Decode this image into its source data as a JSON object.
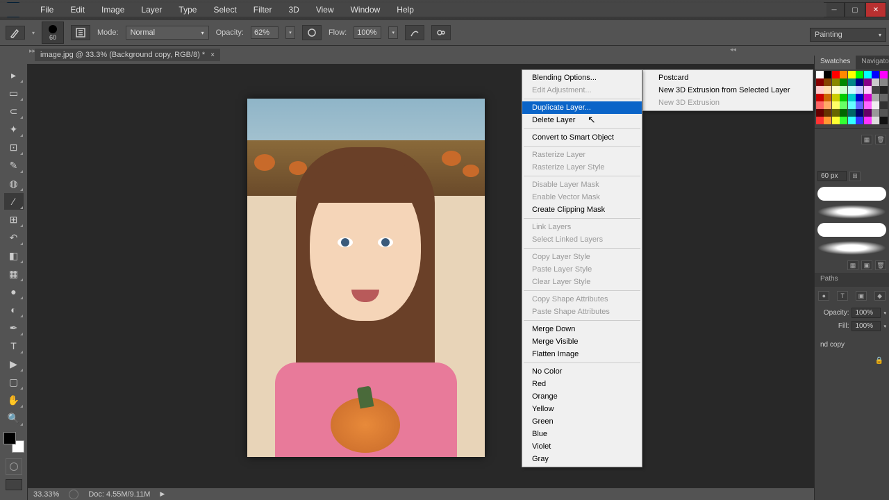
{
  "window": {
    "title": "Ps"
  },
  "menubar": [
    "File",
    "Edit",
    "Image",
    "Layer",
    "Type",
    "Select",
    "Filter",
    "3D",
    "View",
    "Window",
    "Help"
  ],
  "options": {
    "brush_size": "60",
    "mode_label": "Mode:",
    "mode_value": "Normal",
    "opacity_label": "Opacity:",
    "opacity_value": "62%",
    "flow_label": "Flow:",
    "flow_value": "100%",
    "workspace": "Painting"
  },
  "document": {
    "tab_label": "image.jpg @ 33.3% (Background copy, RGB/8) *"
  },
  "statusbar": {
    "zoom": "33.33%",
    "doc_info": "Doc: 4.55M/9.11M"
  },
  "context_menu": {
    "groups": [
      [
        {
          "label": "Blending Options...",
          "enabled": true
        },
        {
          "label": "Edit Adjustment...",
          "enabled": false
        }
      ],
      [
        {
          "label": "Duplicate Layer...",
          "enabled": true,
          "highlight": true
        },
        {
          "label": "Delete Layer",
          "enabled": true
        }
      ],
      [
        {
          "label": "Convert to Smart Object",
          "enabled": true
        }
      ],
      [
        {
          "label": "Rasterize Layer",
          "enabled": false
        },
        {
          "label": "Rasterize Layer Style",
          "enabled": false
        }
      ],
      [
        {
          "label": "Disable Layer Mask",
          "enabled": false
        },
        {
          "label": "Enable Vector Mask",
          "enabled": false
        },
        {
          "label": "Create Clipping Mask",
          "enabled": true
        }
      ],
      [
        {
          "label": "Link Layers",
          "enabled": false
        },
        {
          "label": "Select Linked Layers",
          "enabled": false
        }
      ],
      [
        {
          "label": "Copy Layer Style",
          "enabled": false
        },
        {
          "label": "Paste Layer Style",
          "enabled": false
        },
        {
          "label": "Clear Layer Style",
          "enabled": false
        }
      ],
      [
        {
          "label": "Copy Shape Attributes",
          "enabled": false
        },
        {
          "label": "Paste Shape Attributes",
          "enabled": false
        }
      ],
      [
        {
          "label": "Merge Down",
          "enabled": true
        },
        {
          "label": "Merge Visible",
          "enabled": true
        },
        {
          "label": "Flatten Image",
          "enabled": true
        }
      ],
      [
        {
          "label": "No Color",
          "enabled": true
        },
        {
          "label": "Red",
          "enabled": true
        },
        {
          "label": "Orange",
          "enabled": true
        },
        {
          "label": "Yellow",
          "enabled": true
        },
        {
          "label": "Green",
          "enabled": true
        },
        {
          "label": "Blue",
          "enabled": true
        },
        {
          "label": "Violet",
          "enabled": true
        },
        {
          "label": "Gray",
          "enabled": true
        }
      ]
    ]
  },
  "submenu": [
    {
      "label": "Postcard",
      "enabled": true
    },
    {
      "label": "New 3D Extrusion from Selected Layer",
      "enabled": true
    },
    {
      "label": "New 3D Extrusion",
      "enabled": false
    }
  ],
  "panels": {
    "swatches_tab": "Swatches",
    "navigator_tab": "Navigator",
    "paths_tab": "Paths",
    "brush_size": "60 px",
    "opacity_label": "Opacity:",
    "opacity_value": "100%",
    "fill_label": "Fill:",
    "fill_value": "100%",
    "layer_name": "nd copy"
  },
  "swatch_colors": [
    "#ffffff",
    "#000000",
    "#ff0000",
    "#ff8800",
    "#ffff00",
    "#00ff00",
    "#00ffff",
    "#0000ff",
    "#ff00ff",
    "#880000",
    "#884400",
    "#888800",
    "#008800",
    "#008888",
    "#000088",
    "#880088",
    "#cccccc",
    "#888888",
    "#ffcccc",
    "#ffddaa",
    "#ffffcc",
    "#ccffcc",
    "#ccffff",
    "#ccccff",
    "#ffccff",
    "#444444",
    "#222222",
    "#cc0000",
    "#cc6600",
    "#cccc00",
    "#00cc00",
    "#00cccc",
    "#0000cc",
    "#cc00cc",
    "#aaaaaa",
    "#666666",
    "#ff6666",
    "#ffaa66",
    "#ffff66",
    "#66ff66",
    "#66ffff",
    "#6666ff",
    "#ff66ff",
    "#eeeeee",
    "#333333",
    "#660000",
    "#663300",
    "#666600",
    "#006600",
    "#006666",
    "#000066",
    "#660066",
    "#999999",
    "#555555",
    "#ff3333",
    "#ff9933",
    "#ffff33",
    "#33ff33",
    "#33ffff",
    "#3333ff",
    "#ff33ff",
    "#dddddd",
    "#111111"
  ],
  "tools": [
    {
      "name": "move-tool",
      "icon": "▸"
    },
    {
      "name": "marquee-tool",
      "icon": "▭"
    },
    {
      "name": "lasso-tool",
      "icon": "⊂"
    },
    {
      "name": "magic-wand-tool",
      "icon": "✦"
    },
    {
      "name": "crop-tool",
      "icon": "⊡"
    },
    {
      "name": "eyedropper-tool",
      "icon": "✎"
    },
    {
      "name": "healing-brush-tool",
      "icon": "◍"
    },
    {
      "name": "brush-tool",
      "icon": "∕",
      "selected": true
    },
    {
      "name": "clone-stamp-tool",
      "icon": "⊞"
    },
    {
      "name": "history-brush-tool",
      "icon": "↶"
    },
    {
      "name": "eraser-tool",
      "icon": "◧"
    },
    {
      "name": "gradient-tool",
      "icon": "▦"
    },
    {
      "name": "blur-tool",
      "icon": "●"
    },
    {
      "name": "dodge-tool",
      "icon": "◐"
    },
    {
      "name": "pen-tool",
      "icon": "✒"
    },
    {
      "name": "type-tool",
      "icon": "T"
    },
    {
      "name": "path-selection-tool",
      "icon": "▶"
    },
    {
      "name": "rectangle-tool",
      "icon": "▢"
    },
    {
      "name": "hand-tool",
      "icon": "✋"
    },
    {
      "name": "zoom-tool",
      "icon": "🔍"
    }
  ]
}
